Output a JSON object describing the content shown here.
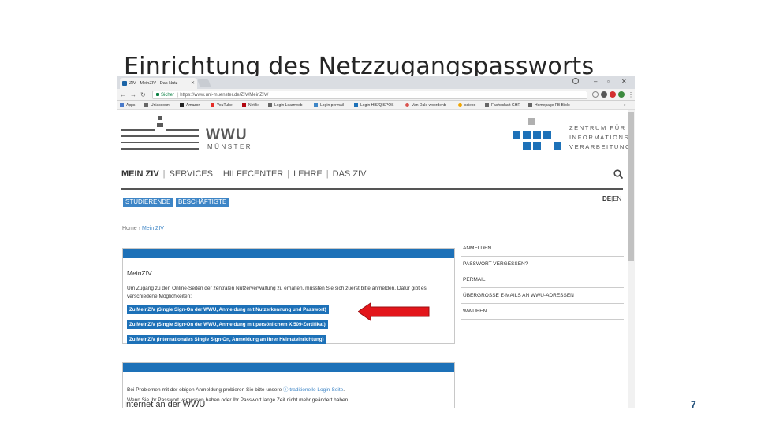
{
  "slide": {
    "title": "Einrichtung des Netzzugangspassworts",
    "footer": "Internet an der WWU",
    "page_number": "7"
  },
  "browser": {
    "tab_title": "ZIV - MeinZIV - Das Nutz",
    "secure_label": "Sicher",
    "url_host": "https://www.uni-muenster.de",
    "url_path": "/ZIV/MeinZIV/",
    "bookmarks": [
      "Apps",
      "Uniaccount",
      "Amazon",
      "YouTube",
      "Netflix",
      "Login Learnweb",
      "Login permail",
      "Login HIS/QISPOS",
      "Van Dale woordenb",
      "sciebo",
      "Fachschaft GHR",
      "Homepage FB Biolo"
    ],
    "more_bookmarks": "»"
  },
  "page": {
    "wwu_name": "WWU",
    "wwu_city": "MÜNSTER",
    "ziv_lines": [
      "ZENTRUM FÜR",
      "INFORMATIONS",
      "VERARBEITUNG"
    ],
    "nav": [
      "MEIN ZIV",
      "SERVICES",
      "HILFECENTER",
      "LEHRE",
      "DAS ZIV"
    ],
    "subnav": [
      "STUDIERENDE",
      "BESCHÄFTIGTE"
    ],
    "lang_de": "DE",
    "lang_sep": "|",
    "lang_en": "EN",
    "breadcrumb_home": "Home",
    "breadcrumb_sep": "›",
    "breadcrumb_current": "Mein ZIV",
    "box_title": "MeinZIV",
    "box_text": "Um Zugang zu den Online-Seiten der zentralen Nutzerverwaltung zu erhalten, müssten Sie sich zuerst bitte anmelden. Dafür gibt es verschiedene Möglichkeiten:",
    "login_links": [
      "Zu MeinZIV (Single Sign-On der WWU, Anmeldung mit Nutzerkennung und Passwort)",
      "Zu MeinZIV (Single Sign-On der WWU, Anmeldung mit persönlichem X.509-Zertifikat)",
      "Zu MeinZIV (Internationales Single Sign-On, Anmeldung an Ihrer Heimateinrichtung)"
    ],
    "box2_text_before": "Bei Problemen mit der obigen Anmeldung probieren Sie bitte unsere",
    "box2_link": "traditionelle Login-Seite",
    "box2_text_after": ".",
    "box2_text2": "Wenn Sie Ihr Passwort vergessen haben oder Ihr Passwort lange Zeit nicht mehr geändert haben.",
    "side_menu": [
      "ANMELDEN",
      "PASSWORT VERGESSEN?",
      "PERMAIL",
      "ÜBERGROSSE E-MAILS AN WWU-ADRESSEN",
      "WWUBEN"
    ]
  },
  "colors": {
    "wwu_blue": "#1d71b8",
    "link_blue": "#3d85c6",
    "arrow_red": "#e3161b",
    "page_number": "#1f4e79"
  }
}
